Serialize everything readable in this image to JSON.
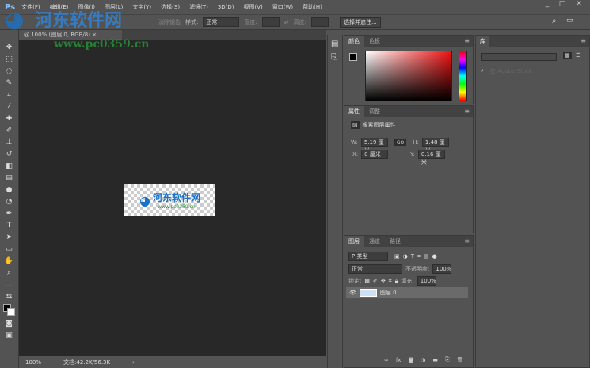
{
  "app": {
    "logo": "Ps",
    "watermark_name": "河东软件网",
    "watermark_url": "www.pc0359.cn"
  },
  "menu": [
    "文件(F)",
    "编辑(E)",
    "图像(I)",
    "图层(L)",
    "文字(Y)",
    "选择(S)",
    "滤镜(T)",
    "3D(D)",
    "视图(V)",
    "窗口(W)",
    "帮助(H)"
  ],
  "window": {
    "min": "_",
    "max": "□",
    "close": "✕"
  },
  "options": {
    "feather_out": "消除锯齿",
    "style_label": "样式:",
    "style_value": "正常",
    "width_label": "宽度:",
    "height_label": "高度:",
    "select_mask": "选择并遮住..."
  },
  "doc_tab": {
    "title": "@ 100% (图层 0, RGB/8)",
    "close": "×"
  },
  "status": {
    "zoom": "100%",
    "doc": "文档:42.2K/56.3K",
    "arrow": "›"
  },
  "color_panel": {
    "tabs": [
      "颜色",
      "色板"
    ]
  },
  "properties": {
    "tabs": [
      "属性",
      "调整"
    ],
    "title": "像素图层属性",
    "w_label": "W:",
    "w": "5.19 厘米",
    "link": "GO",
    "h_label": "H:",
    "h": "1.48 厘米",
    "x_label": "X:",
    "x": "0 厘米",
    "y_label": "Y:",
    "y": "0.16 厘米"
  },
  "layers": {
    "tabs": [
      "图层",
      "通道",
      "路径"
    ],
    "filter": "P 类型",
    "blend": "正常",
    "opacity_label": "不透明度:",
    "opacity": "100%",
    "lock_label": "锁定:",
    "fill_label": "填充:",
    "fill": "100%",
    "layer_name": "图层 0",
    "footer_icons": [
      "link",
      "fx",
      "mask",
      "adjust",
      "folder",
      "new",
      "trash"
    ]
  },
  "library": {
    "tab": "库",
    "search_placeholder": "在 Adobe Stock"
  }
}
